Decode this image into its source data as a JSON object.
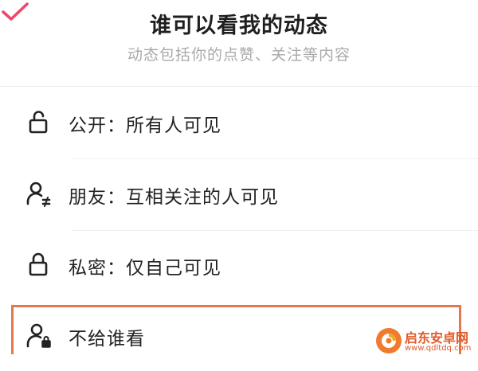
{
  "header": {
    "title": "谁可以看我的动态",
    "subtitle": "动态包括你的点赞、关注等内容"
  },
  "options": [
    {
      "label": "公开：所有人可见",
      "icon": "unlock-icon",
      "selected": true
    },
    {
      "label": "朋友：互相关注的人可见",
      "icon": "friends-icon",
      "selected": false
    },
    {
      "label": "私密：仅自己可见",
      "icon": "lock-icon",
      "selected": false
    },
    {
      "label": "不给谁看",
      "icon": "person-lock-icon",
      "selected": false
    }
  ],
  "colors": {
    "check": "#f0466b",
    "highlight_border": "#e4784a",
    "watermark": "#e05a2a"
  },
  "watermark": {
    "name": "启东安卓网",
    "url": "www.qdltdq.com"
  }
}
